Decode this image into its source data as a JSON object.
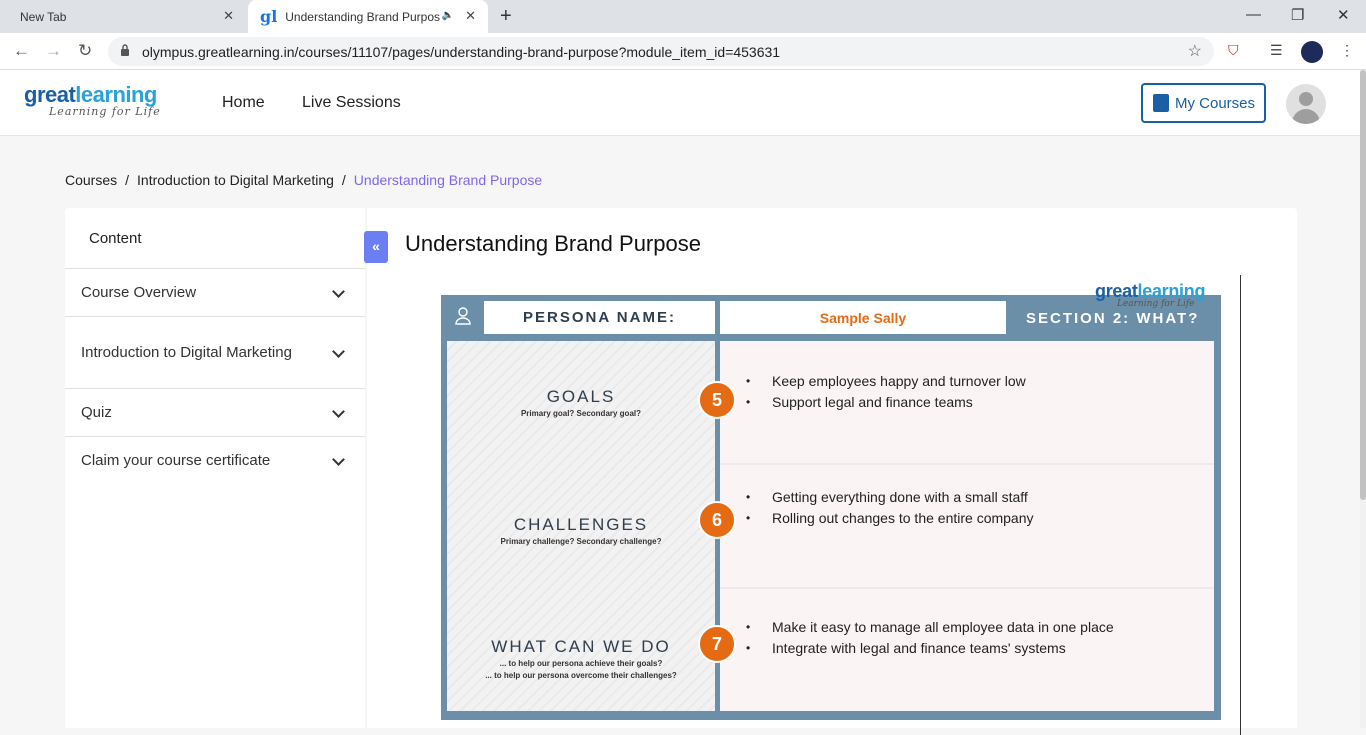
{
  "browser": {
    "tabs": [
      {
        "label": "New Tab"
      },
      {
        "label": "Understanding Brand Purpos",
        "favicon": "gl"
      }
    ],
    "url": "olympus.greatlearning.in/courses/11107/pages/understanding-brand-purpose?module_item_id=453631"
  },
  "header": {
    "logo_main_a": "great",
    "logo_main_b": "learning",
    "logo_tagline": "Learning for Life",
    "nav": [
      "Home",
      "Live Sessions"
    ],
    "my_courses": "My Courses"
  },
  "breadcrumb": {
    "items": [
      "Courses",
      "Introduction to Digital Marketing"
    ],
    "current": "Understanding Brand Purpose",
    "separator": "/"
  },
  "sidebar": {
    "heading": "Content",
    "items": [
      {
        "label": "Course Overview"
      },
      {
        "label": "Introduction to Digital Marketing"
      },
      {
        "label": "Quiz"
      },
      {
        "label": "Claim your course certificate"
      }
    ]
  },
  "main": {
    "title": "Understanding Brand Purpose",
    "slide": {
      "watermark_a": "great",
      "watermark_b": "learning",
      "watermark_tagline": "Learning for Life",
      "persona_label": "PERSONA NAME:",
      "persona_value": "Sample Sally",
      "section_label": "SECTION 2: WHAT?",
      "rows": [
        {
          "title": "GOALS",
          "subtitle_1": "Primary goal? Secondary goal?",
          "subtitle_2": "",
          "number": "5",
          "bullets": [
            "Keep employees happy and turnover low",
            "Support legal and finance teams"
          ]
        },
        {
          "title": "CHALLENGES",
          "subtitle_1": "Primary challenge? Secondary challenge?",
          "subtitle_2": "",
          "number": "6",
          "bullets": [
            "Getting everything done with a small staff",
            "Rolling out changes to the entire company"
          ]
        },
        {
          "title": "WHAT CAN WE DO",
          "subtitle_1": "... to help our persona achieve their goals?",
          "subtitle_2": "... to help our persona overcome their challenges?",
          "number": "7",
          "bullets": [
            "Make it easy to manage all employee data in one place",
            "Integrate with legal and finance teams' systems"
          ]
        }
      ]
    }
  },
  "colors": {
    "brand": "#1a5fa6",
    "accent_purple": "#7b68ee",
    "badge_orange": "#e56a14",
    "slide_frame": "#6b8fa8"
  }
}
